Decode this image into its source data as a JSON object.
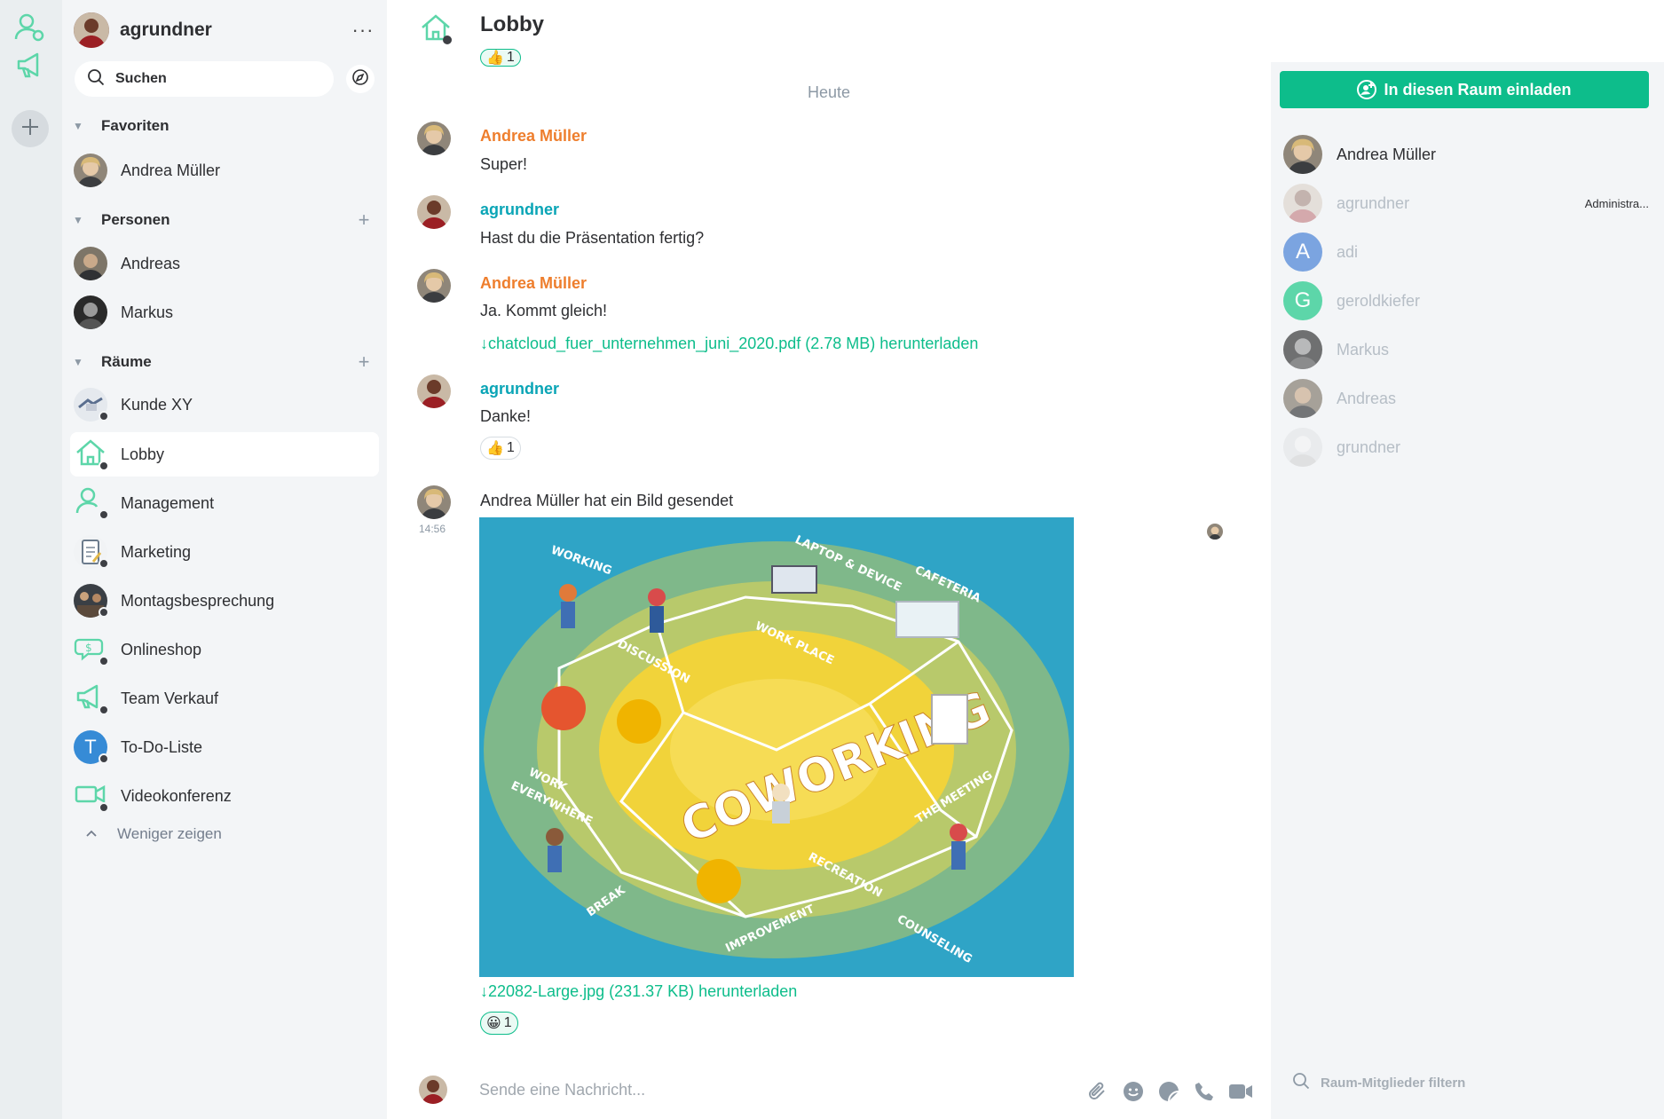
{
  "user": {
    "name": "agrundner",
    "menu_glyph": "···"
  },
  "search": {
    "placeholder": "Suchen"
  },
  "sections": {
    "favorites": "Favoriten",
    "people": "Personen",
    "rooms": "Räume"
  },
  "favorites": [
    {
      "name": "Andrea Müller"
    }
  ],
  "people": [
    {
      "name": "Andreas"
    },
    {
      "name": "Markus"
    }
  ],
  "rooms": [
    {
      "name": "Kunde XY"
    },
    {
      "name": "Lobby",
      "active": true
    },
    {
      "name": "Management"
    },
    {
      "name": "Marketing"
    },
    {
      "name": "Montagsbesprechung"
    },
    {
      "name": "Onlineshop"
    },
    {
      "name": "Team Verkauf"
    },
    {
      "name": "To-Do-Liste",
      "initial": "T"
    },
    {
      "name": "Videokonferenz"
    }
  ],
  "show_less": "Weniger zeigen",
  "room": {
    "title": "Lobby"
  },
  "timeline": {
    "date_separator": "Heute",
    "messages": [
      {
        "sender": "Andrea Müller",
        "text": "Super!"
      },
      {
        "sender": "agrundner",
        "text": "Hast du die Präsentation fertig?"
      },
      {
        "sender": "Andrea Müller",
        "text": "Ja. Kommt gleich!",
        "file": "↓chatcloud_fuer_unternehmen_juni_2020.pdf (2.78 MB) herunterladen"
      },
      {
        "sender": "agrundner",
        "text": "Danke!",
        "reaction": "👍",
        "reaction_count": "1"
      },
      {
        "text": "Andrea Müller hat ein Bild gesendet",
        "time": "14:56",
        "file": "↓22082-Large.jpg (231.37 KB) herunterladen",
        "reaction": "😀",
        "reaction_count": "1"
      }
    ],
    "top_reaction": {
      "emoji": "👍",
      "count": "1"
    }
  },
  "image_labels": {
    "main": "COWORKING",
    "working": "WORKING",
    "discussion": "DISCUSSION",
    "laptop": "LAPTOP & DEVICE",
    "cafeteria": "CAFETERIA",
    "workplace": "WORK PLACE",
    "work_everywhere_1": "WORK",
    "work_everywhere_2": "EVERYWHERE",
    "meeting": "THE MEETING",
    "recreation": "RECREATION",
    "improvement": "IMPROVEMENT",
    "break": "BREAK",
    "counseling": "COUNSELING"
  },
  "composer": {
    "placeholder": "Sende eine Nachricht..."
  },
  "right_panel": {
    "invite_label": "In diesen Raum einladen",
    "filter_placeholder": "Raum-Mitglieder filtern",
    "members": [
      {
        "name": "Andrea Müller"
      },
      {
        "name": "agrundner",
        "role": "Administra..."
      },
      {
        "name": "adi",
        "initial": "A"
      },
      {
        "name": "geroldkiefer",
        "initial": "G"
      },
      {
        "name": "Markus"
      },
      {
        "name": "Andreas"
      },
      {
        "name": "grundner"
      }
    ]
  },
  "colors": {
    "accent": "#0dbd8b",
    "sender_orange": "#ee7e2d",
    "sender_teal": "#0aa5b6",
    "avatar_blue": "#368bd6",
    "avatar_green": "#5dd6a9",
    "avatar_lightblue": "#7ba4e0"
  },
  "icons": {
    "space_home": "people-gear-icon",
    "space_megaphone": "megaphone-icon",
    "space_add": "plus-icon",
    "header": [
      "settings-icon",
      "share-icon",
      "apps-icon",
      "search-icon",
      "members-icon",
      "notes-icon",
      "bell-icon"
    ],
    "composer": [
      "paperclip-icon",
      "emoji-icon",
      "sticker-icon",
      "phone-icon",
      "video-icon"
    ]
  }
}
